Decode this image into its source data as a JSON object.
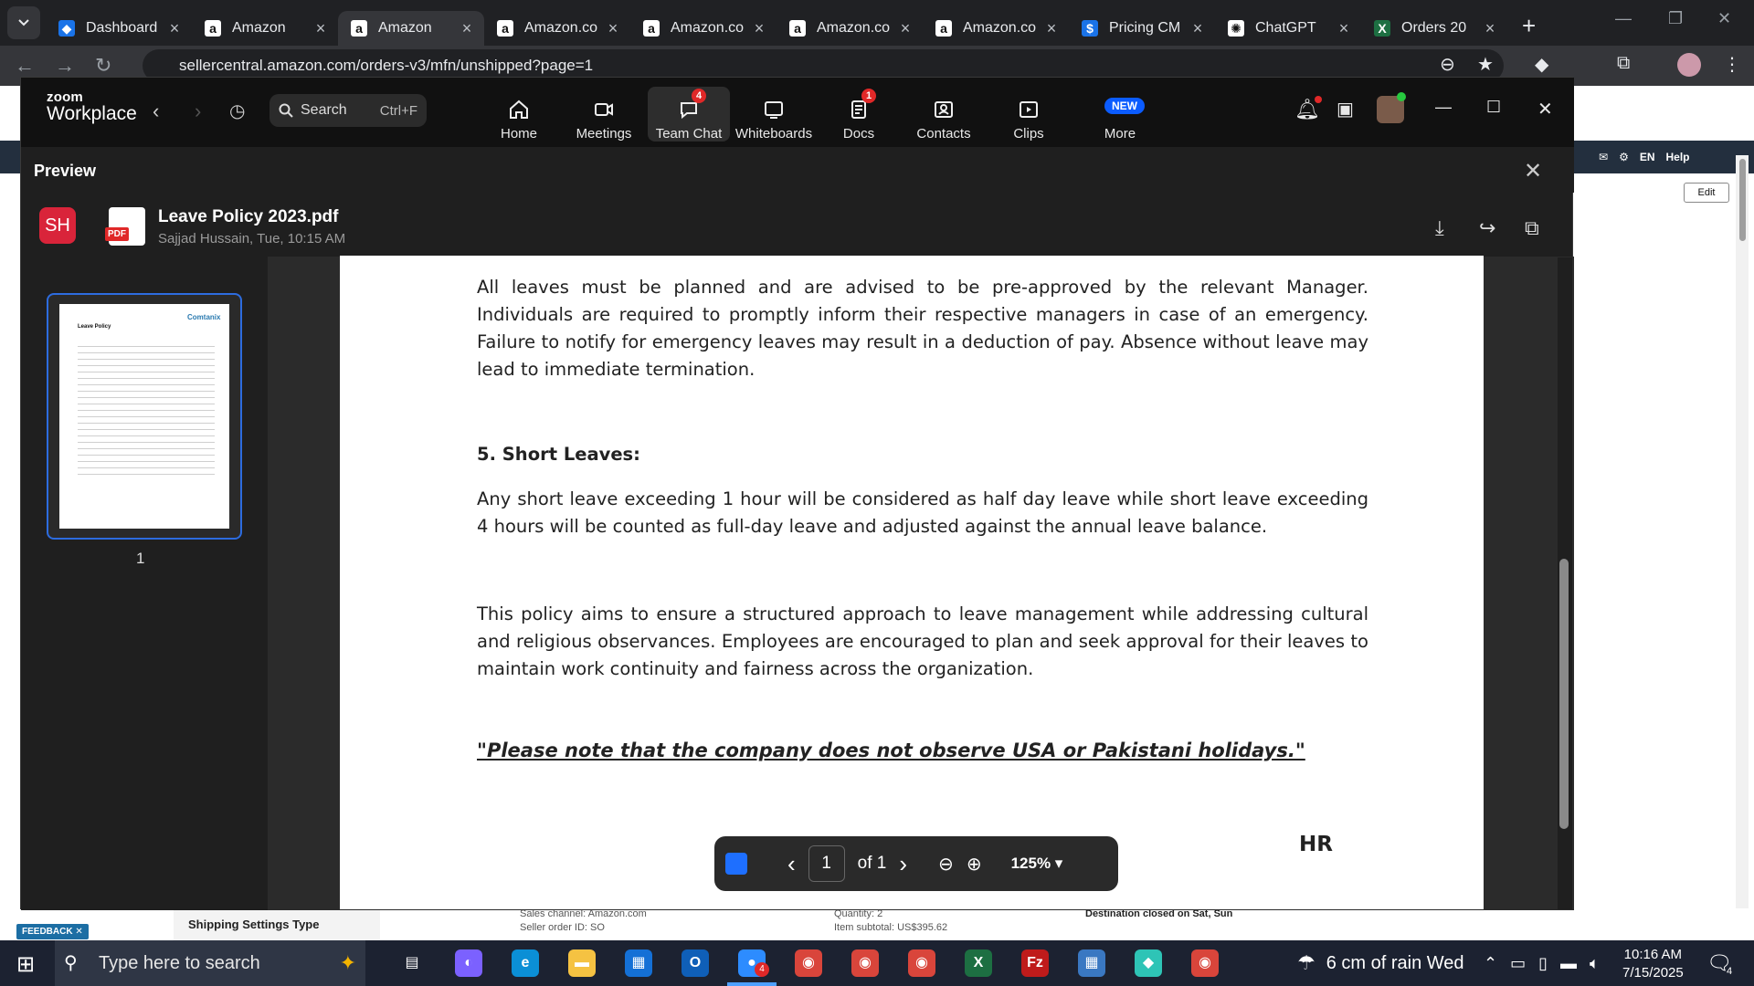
{
  "browser": {
    "tabs": [
      {
        "label": "Dashboard",
        "icon": "app-icon",
        "color": "#1a73e8"
      },
      {
        "label": "Amazon",
        "icon": "amazon-icon",
        "color": "#ffffff"
      },
      {
        "label": "Amazon",
        "icon": "amazon-icon",
        "color": "#ffffff",
        "active": true
      },
      {
        "label": "Amazon.co",
        "icon": "amazon-icon",
        "color": "#ffffff"
      },
      {
        "label": "Amazon.co",
        "icon": "amazon-icon",
        "color": "#ffffff"
      },
      {
        "label": "Amazon.co",
        "icon": "amazon-icon",
        "color": "#ffffff"
      },
      {
        "label": "Amazon.co",
        "icon": "amazon-icon",
        "color": "#ffffff"
      },
      {
        "label": "Pricing CM",
        "icon": "dollar-icon",
        "color": "#1a73e8"
      },
      {
        "label": "ChatGPT",
        "icon": "chatgpt-icon",
        "color": "#ffffff"
      },
      {
        "label": "Orders 20",
        "icon": "excel-icon",
        "color": "#1d6f42"
      }
    ],
    "url": "sellercentral.amazon.com/orders-v3/mfn/unshipped?page=1"
  },
  "amazon_bg": {
    "lang": "EN",
    "help": "Help",
    "edit": "Edit",
    "shipping_settings": "Shipping Settings Type",
    "sales_channel": "Sales channel: Amazon.com",
    "seller_order": "Seller order ID: SO",
    "quantity": "Quantity: 2",
    "subtotal": "Item subtotal: US$395.62",
    "destination": "Destination closed on Sat, Sun",
    "feedback": "FEEDBACK"
  },
  "zoom": {
    "logo_top": "zoom",
    "logo_bottom": "Workplace",
    "search_label": "Search",
    "search_shortcut": "Ctrl+F",
    "nav": [
      {
        "label": "Home",
        "icon": "home-icon"
      },
      {
        "label": "Meetings",
        "icon": "video-icon"
      },
      {
        "label": "Team Chat",
        "icon": "chat-icon",
        "badge": "4",
        "active": true
      },
      {
        "label": "Whiteboards",
        "icon": "whiteboard-icon"
      },
      {
        "label": "Docs",
        "icon": "docs-icon",
        "badge": "1"
      },
      {
        "label": "Contacts",
        "icon": "contacts-icon"
      },
      {
        "label": "Clips",
        "icon": "clips-icon"
      },
      {
        "label": "More",
        "icon": "more-icon",
        "new": "NEW"
      }
    ],
    "preview_title": "Preview",
    "sender_initials": "SH",
    "file_name": "Leave Policy 2023.pdf",
    "file_meta": "Sajjad Hussain, Tue, 10:15 AM",
    "pdf_badge": "PDF",
    "thumb_page": "1",
    "thumb_logo": "Comtanix",
    "thumb_title": "Leave Policy",
    "doc": {
      "para1": "All leaves must be planned and are advised to be pre-approved by the relevant Manager. Individuals are required to promptly inform their respective managers in case of an emergency. Failure to notify for emergency leaves may result in a deduction of pay. Absence without leave may lead to immediate termination.",
      "heading5": "5. Short Leaves:",
      "para2": "Any short leave exceeding 1 hour will be considered as half day leave while short leave exceeding 4 hours will be counted as full-day leave and adjusted against the annual leave balance.",
      "para3": "This policy aims to ensure a structured approach to leave management while addressing cultural and religious observances. Employees are encouraged to plan and seek approval for their leaves to maintain work continuity and fairness across the organization.",
      "note": "\"Please note that the company does not observe USA or Pakistani holidays.\"",
      "signature": "HR"
    },
    "pager": {
      "current": "1",
      "of_label": "of 1",
      "zoom_level": "125%"
    }
  },
  "taskbar": {
    "search_placeholder": "Type here to search",
    "weather": "6 cm of rain Wed",
    "time": "10:16 AM",
    "date": "7/15/2025",
    "notif_count": "4",
    "zoom_badge": "4"
  }
}
